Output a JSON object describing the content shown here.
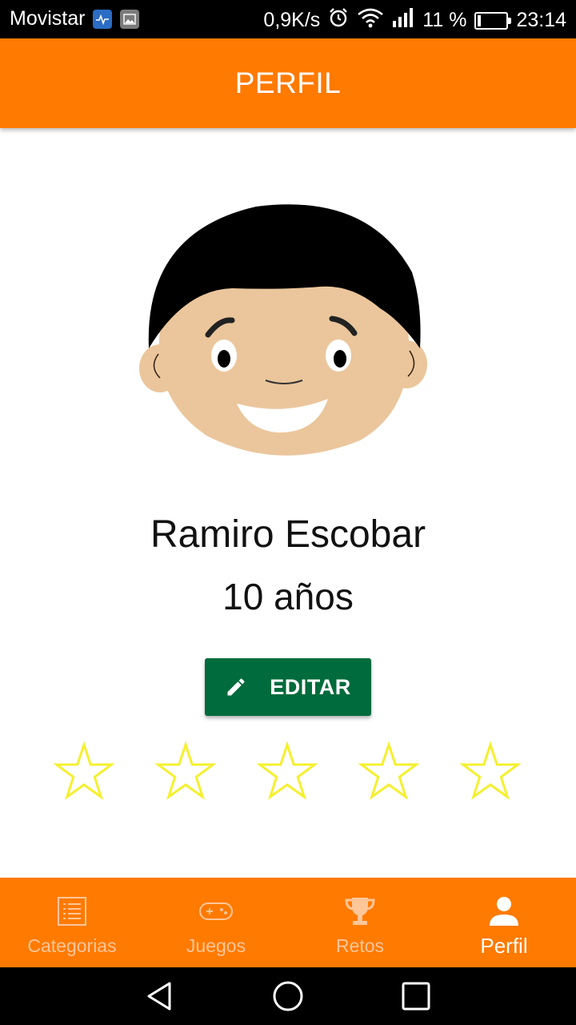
{
  "status_bar": {
    "carrier": "Movistar",
    "net_speed": "0,9K/s",
    "battery_percent_text": "11 %",
    "battery_level": 0.11,
    "time": "23:14",
    "icons": [
      "health-notification-icon",
      "gallery-notification-icon",
      "alarm-icon",
      "wifi-icon",
      "signal-icon",
      "battery-icon"
    ]
  },
  "header": {
    "title": "PERFIL"
  },
  "profile": {
    "name": "Ramiro Escobar",
    "age": "10 años",
    "edit_label": "EDITAR",
    "rating": {
      "filled": 0,
      "total": 5
    },
    "colors": {
      "star": "#f5f02e",
      "edit_button": "#006b3c"
    }
  },
  "bottom_nav": {
    "items": [
      {
        "label": "Categorias",
        "icon": "list-icon",
        "active": false
      },
      {
        "label": "Juegos",
        "icon": "gamepad-icon",
        "active": false
      },
      {
        "label": "Retos",
        "icon": "trophy-icon",
        "active": false
      },
      {
        "label": "Perfil",
        "icon": "person-icon",
        "active": true
      }
    ]
  },
  "colors": {
    "accent": "#ff7a00",
    "nav_inactive": "#ffc699",
    "nav_active": "#ffffff"
  }
}
